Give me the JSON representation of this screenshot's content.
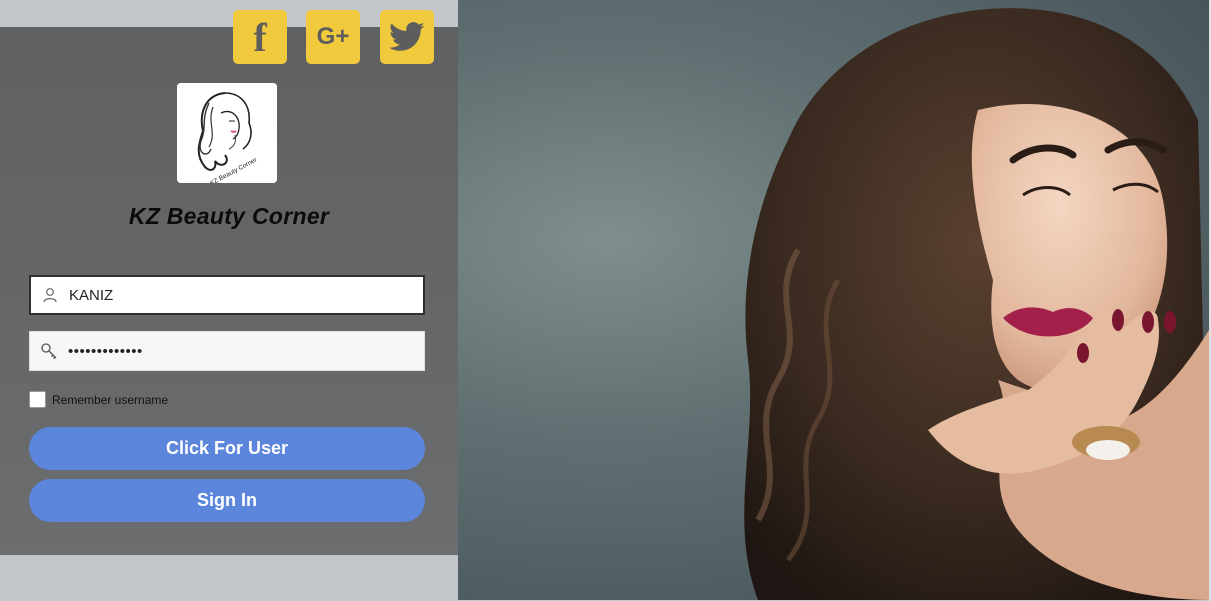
{
  "social": {
    "facebook_icon": "facebook-icon",
    "googleplus_icon": "google-plus-icon",
    "twitter_icon": "twitter-icon",
    "facebook_glyph": "f",
    "googleplus_glyph": "G+"
  },
  "brand": {
    "logo_text": "KZ Beauty Corner",
    "title": "KZ Beauty Corner"
  },
  "login": {
    "username_value": "KANIZ",
    "password_value": "•••••••••••••",
    "remember_label": "Remember username",
    "user_button": "Click For User",
    "signin_button": "Sign In"
  },
  "colors": {
    "accent": "#f0c93c",
    "button": "#5b86db",
    "panel": "#636567"
  }
}
